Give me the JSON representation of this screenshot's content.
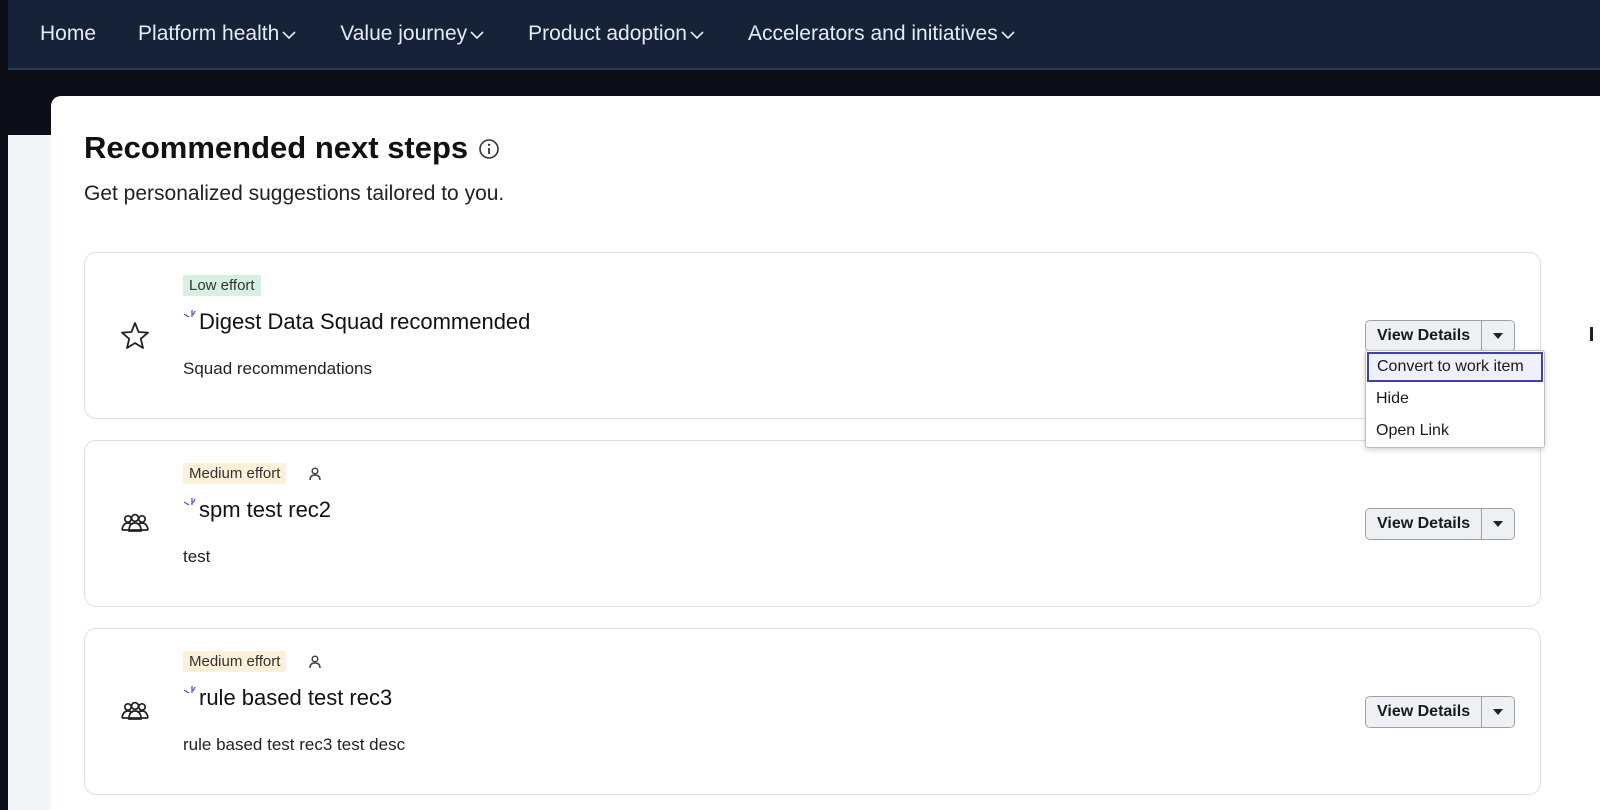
{
  "nav": {
    "items": [
      {
        "label": "Home",
        "has_dropdown": false
      },
      {
        "label": "Platform health",
        "has_dropdown": true
      },
      {
        "label": "Value journey",
        "has_dropdown": true
      },
      {
        "label": "Product adoption",
        "has_dropdown": true
      },
      {
        "label": "Accelerators and initiatives",
        "has_dropdown": true
      }
    ]
  },
  "main": {
    "title": "Recommended next steps",
    "subtitle": "Get personalized suggestions tailored to you."
  },
  "recommendations": [
    {
      "effort": "Low effort",
      "effort_level": "low",
      "icon": "star-icon",
      "has_person_icon": false,
      "title": "Digest Data Squad recommended",
      "description": "Squad recommendations",
      "button": "View Details"
    },
    {
      "effort": "Medium effort",
      "effort_level": "medium",
      "icon": "group-icon",
      "has_person_icon": true,
      "title": "spm test rec2",
      "description": "test",
      "button": "View Details"
    },
    {
      "effort": "Medium effort",
      "effort_level": "medium",
      "icon": "group-icon",
      "has_person_icon": true,
      "title": "rule based test rec3",
      "description": "rule based test rec3 test desc",
      "button": "View Details"
    }
  ],
  "dropdown_menu": {
    "items": [
      "Convert to work item",
      "Hide",
      "Open Link"
    ],
    "highlighted": "Convert to work item"
  },
  "colors": {
    "nav_bg": "#152238",
    "low_badge": "#d6f0e1",
    "medium_badge": "#fbf0d8",
    "menu_focus": "#3f3fb0"
  }
}
